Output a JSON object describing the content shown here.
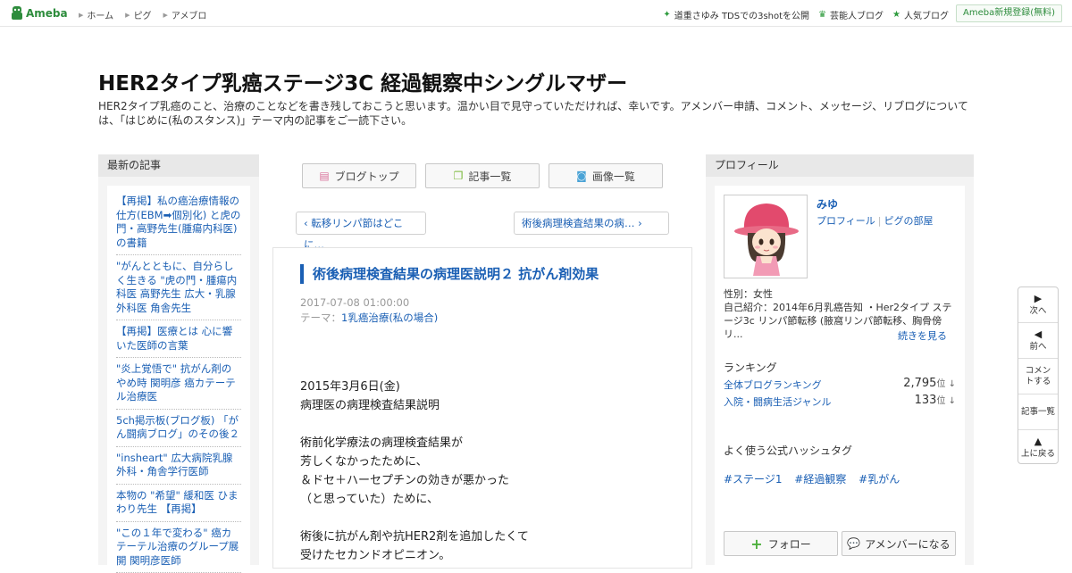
{
  "header": {
    "logo_text": "Ameba",
    "nav": [
      "ホーム",
      "ピグ",
      "アメブロ"
    ],
    "right_links": [
      {
        "icon": "star-icon",
        "label": "道重さゆみ TDSでの3shotを公開"
      },
      {
        "icon": "crown-icon",
        "label": "芸能人ブログ"
      },
      {
        "icon": "star-icon",
        "label": "人気ブログ"
      }
    ],
    "register_label": "Ameba新規登録(無料)"
  },
  "blog": {
    "title": "HER2タイプ乳癌ステージ3C 経過観察中シングルマザー",
    "description": "HER2タイプ乳癌のこと、治療のことなどを書き残しておこうと思います。温かい目で見守っていただければ、幸いです。アメンバー申請、コメント、メッセージ、リブログについては、「はじめに(私のスタンス)」テーマ内の記事をご一読下さい。"
  },
  "left": {
    "heading": "最新の記事",
    "items": [
      "【再掲】私の癌治療情報の仕方(EBM➡個別化) と虎の門・高野先生(腫瘍内科医)の書籍",
      "\"がんとともに、自分らしく生きる \"虎の門・腫瘍内科医 高野先生 広大・乳腺外科医 角舎先生",
      "【再掲】医療とは 心に響いた医師の言葉",
      "\"炎上覚悟で\" 抗がん剤のやめ時 関明彦 癌カテーテル治療医",
      "5ch掲示板(ブログ板) 「がん闘病ブログ」のその後２",
      "\"insheart\" 広大病院乳腺外科・角舎学行医師",
      "本物の \"希望\" 緩和医 ひまわり先生 【再掲】",
      "\"この１年で変わる\" 癌カテーテル治療のグループ展開 関明彦医師"
    ]
  },
  "center": {
    "nav_buttons": [
      {
        "icon": "blog-top-icon",
        "label": "ブログトップ"
      },
      {
        "icon": "list-icon",
        "label": "記事一覧"
      },
      {
        "icon": "camera-icon",
        "label": "画像一覧"
      }
    ],
    "prev_label": "‹ 転移リンパ節はどこに…",
    "next_label": "術後病理検査結果の病… ›",
    "article": {
      "title": "術後病理検査結果の病理医説明２ 抗がん剤効果",
      "date": "2017-07-08 01:00:00",
      "theme_label": "テーマ：",
      "theme_value": "1乳癌治療(私の場合)",
      "body": [
        "2015年3月6日(金)",
        "病理医の病理検査結果説明",
        "",
        "術前化学療法の病理検査結果が",
        "芳しくなかったために、",
        "＆ドセ＋ハーセプチンの効きが悪かった",
        "（と思っていた）ために、",
        "",
        "術後に抗がん剤や抗HER2剤を追加したくて",
        "受けたセカンドオピニオン。"
      ]
    }
  },
  "right": {
    "heading": "プロフィール",
    "name": "みゆ",
    "profile_link": "プロフィール",
    "pig_link": "ピグの部屋",
    "gender": "性別：女性",
    "intro": "自己紹介：2014年6月乳癌告知 ・Her2タイプ ステージ3c リンパ節転移 (腋窩リンパ節転移、胸骨傍リ...",
    "more_label": "続きを見る",
    "ranking_heading": "ランキング",
    "rankings": [
      {
        "label": "全体ブログランキング",
        "value": "2,795",
        "unit": "位 ↓"
      },
      {
        "label": "入院・闘病生活ジャンル",
        "value": "133",
        "unit": "位 ↓"
      }
    ],
    "hashtag_heading": "よく使う公式ハッシュタグ",
    "hashtags": [
      "#ステージ1",
      "#経過観察",
      "#乳がん"
    ],
    "follow_label": "フォロー",
    "amember_label": "アメンバーになる"
  },
  "floatnav": [
    {
      "icon": "next-icon",
      "label": "次へ"
    },
    {
      "icon": "prev-icon",
      "label": "前へ"
    },
    {
      "icon": "",
      "label": "コメントする"
    },
    {
      "icon": "",
      "label": "記事一覧"
    },
    {
      "icon": "up-icon",
      "label": "上に戻る"
    }
  ]
}
